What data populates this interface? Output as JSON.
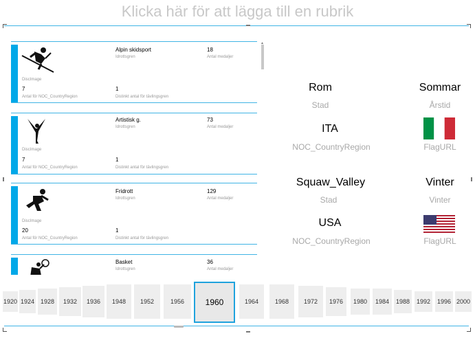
{
  "title_placeholder": "Klicka här för att lägga till en rubrik",
  "cards": [
    {
      "icon": "alpine-skiing-icon",
      "sport": "Alpin skidsport",
      "sport_label": "Idrottsgren",
      "medals": "18",
      "medals_label": "Antal medaljer",
      "image_label": "DiscImage",
      "count": "7",
      "count_label": "Antal för NOC_CountryRegion",
      "distinct": "1",
      "distinct_label": "Distinkt antal för tävlingsgren"
    },
    {
      "icon": "artistic-gymnastics-icon",
      "sport": "Artistisk g.",
      "sport_label": "Idrottsgren",
      "medals": "73",
      "medals_label": "Antal medaljer",
      "image_label": "DiscImage",
      "count": "7",
      "count_label": "Antal för NOC_CountryRegion",
      "distinct": "1",
      "distinct_label": "Distinkt antal för tävlingsgren"
    },
    {
      "icon": "athletics-runner-icon",
      "sport": "Fridrott",
      "sport_label": "Idrottsgren",
      "medals": "129",
      "medals_label": "Antal medaljer",
      "image_label": "DiscImage",
      "count": "20",
      "count_label": "Antal för NOC_CountryRegion",
      "distinct": "1",
      "distinct_label": "Distinkt antal för tävlingsgren"
    },
    {
      "icon": "basketball-icon",
      "sport": "Basket",
      "sport_label": "Idrottsgren",
      "medals": "36",
      "medals_label": "Antal medaljer"
    }
  ],
  "host1": {
    "city": "Rom",
    "city_label": "Stad",
    "season": "Sommar",
    "season_label": "Årstid",
    "noc": "ITA",
    "noc_label": "NOC_CountryRegion",
    "flag_label": "FlagURL",
    "flag": "italy-flag-icon"
  },
  "host2": {
    "city": "Squaw_Valley",
    "city_label": "Stad",
    "season": "Vinter",
    "season_label": "Vinter",
    "noc": "USA",
    "noc_label": "NOC_CountryRegion",
    "flag_label": "FlagURL",
    "flag": "usa-flag-icon"
  },
  "years": [
    "1920",
    "1924",
    "1928",
    "1932",
    "1936",
    "1948",
    "1952",
    "1956",
    "1960",
    "1964",
    "1968",
    "1972",
    "1976",
    "1980",
    "1984",
    "1988",
    "1992",
    "1996",
    "2000"
  ],
  "selected_year": "1960",
  "colors": {
    "accent": "#00a8e8",
    "frame": "#3fb4e5",
    "italy_green": "#009246",
    "italy_red": "#ce2b37"
  }
}
